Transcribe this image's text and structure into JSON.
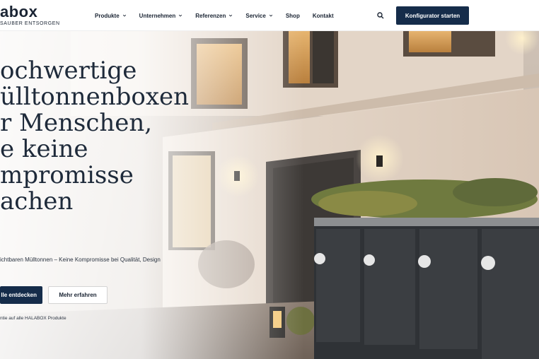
{
  "brand": {
    "logo_text": "abox",
    "tagline": "SAUBER ENTSORGEN"
  },
  "nav": {
    "items": [
      {
        "label": "Produkte",
        "has_dropdown": true
      },
      {
        "label": "Unternehmen",
        "has_dropdown": true
      },
      {
        "label": "Referenzen",
        "has_dropdown": true
      },
      {
        "label": "Service",
        "has_dropdown": true
      },
      {
        "label": "Shop",
        "has_dropdown": false
      },
      {
        "label": "Kontakt",
        "has_dropdown": false
      }
    ],
    "search_icon": "search-icon",
    "cta_label": "Konfigurator starten"
  },
  "hero": {
    "headline": "ochwertige\nülltonnenboxen\nr Menschen,\ne keine\nmpromisse\nachen",
    "subline": "ichtbaren Mülltonnen – Keine Kompromisse bei Qualität, Design",
    "primary_button": "lle entdecken",
    "secondary_button": "Mehr erfahren",
    "note": "ntie auf alle HALABOX Produkte"
  },
  "colors": {
    "brand_navy": "#152c4a",
    "text_dark": "#1e2a3a"
  }
}
